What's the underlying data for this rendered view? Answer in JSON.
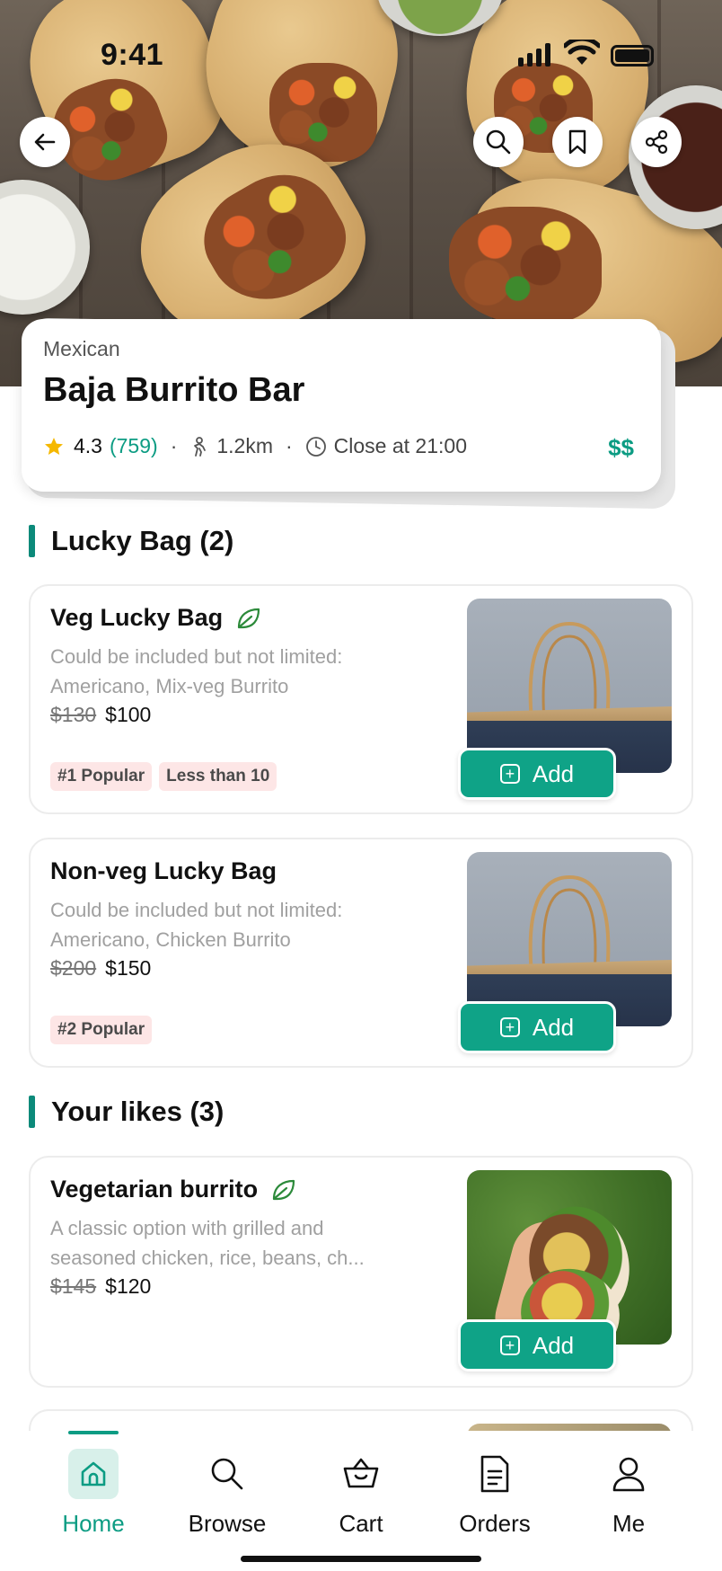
{
  "status_bar": {
    "time": "9:41"
  },
  "restaurant": {
    "cuisine": "Mexican",
    "name": "Baja Burrito Bar",
    "rating": "4.3",
    "rating_count": "(759)",
    "distance": "1.2km",
    "closing": "Close at 21:00",
    "price_level": "$$"
  },
  "sections": {
    "lucky_bag": {
      "title": "Lucky Bag (2)"
    },
    "likes": {
      "title": "Your likes (3)"
    }
  },
  "lucky_bag_items": [
    {
      "name": "Veg Lucky Bag",
      "desc_line1": "Could be included but not limited:",
      "desc_line2": "Americano, Mix-veg Burrito",
      "old_price": "$130",
      "price": "$100",
      "tag1": "#1 Popular",
      "tag2": "Less than 10",
      "add_label": "Add"
    },
    {
      "name": "Non-veg Lucky Bag",
      "desc_line1": "Could be included but not limited:",
      "desc_line2": "Americano, Chicken Burrito",
      "old_price": "$200",
      "price": "$150",
      "tag1": "#2 Popular",
      "add_label": "Add"
    }
  ],
  "likes_items": [
    {
      "name": "Vegetarian burrito",
      "desc_line1": "A classic option with grilled and",
      "desc_line2": "seasoned chicken, rice, beans, ch...",
      "old_price": "$145",
      "price": "$120",
      "add_label": "Add"
    }
  ],
  "tabbar": {
    "home": "Home",
    "browse": "Browse",
    "cart": "Cart",
    "orders": "Orders",
    "me": "Me"
  },
  "icons": {
    "back": "arrow-left-icon",
    "search": "search-icon",
    "bookmark": "bookmark-icon",
    "share": "share-icon",
    "star": "star-icon",
    "distance": "walk-icon",
    "clock": "clock-icon",
    "leaf": "leaf-icon",
    "add": "plus-square-icon"
  },
  "colors": {
    "accent": "#0c9c83",
    "add_button": "#0fa387",
    "tag_bg": "#fde6e6",
    "star": "#f5b800"
  }
}
